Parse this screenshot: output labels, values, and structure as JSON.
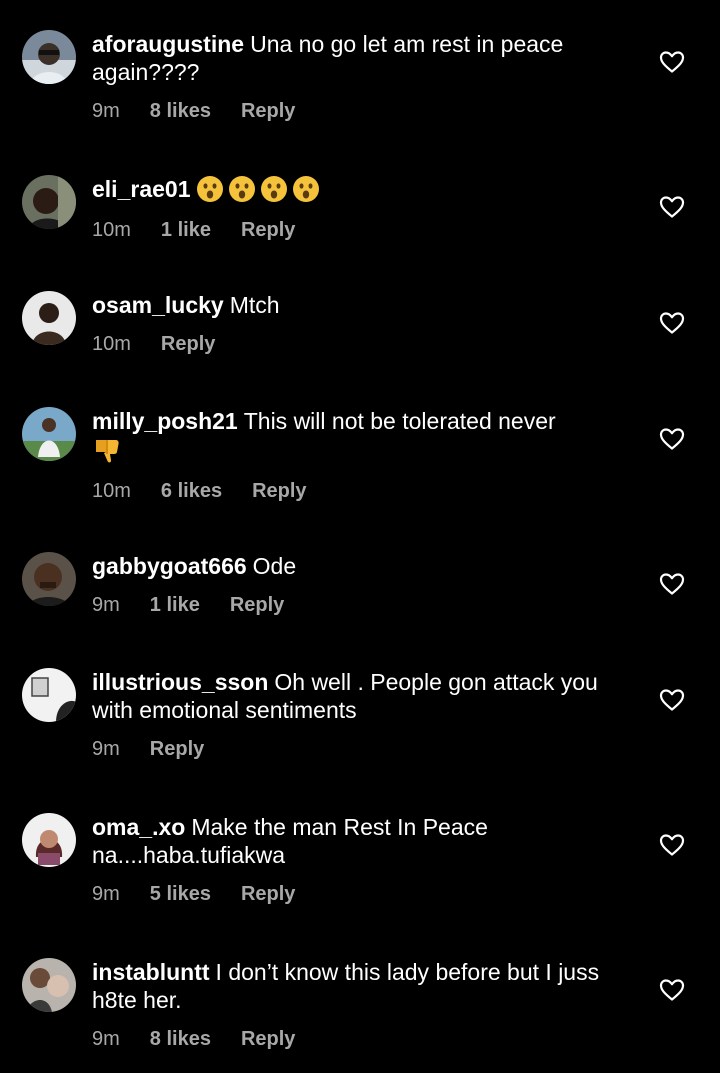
{
  "colors": {
    "background": "#000000",
    "text": "#ffffff",
    "meta": "#a8a8a8"
  },
  "comments": [
    {
      "username": "aforaugustine",
      "text": "Una no go let am rest in peace again????",
      "time": "9m",
      "likes": "8 likes",
      "reply": "Reply",
      "avatar": "profile-photo"
    },
    {
      "username": "eli_rae01",
      "text": "",
      "emojis": [
        "astonished-face",
        "astonished-face",
        "astonished-face",
        "astonished-face"
      ],
      "time": "10m",
      "likes": "1 like",
      "reply": "Reply",
      "avatar": "profile-photo"
    },
    {
      "username": "osam_lucky",
      "text": "Mtch",
      "time": "10m",
      "likes": "",
      "reply": "Reply",
      "avatar": "profile-photo"
    },
    {
      "username": "milly_posh21",
      "text": "This will not be tolerated never",
      "emojis": [
        "thumbs-down"
      ],
      "time": "10m",
      "likes": "6 likes",
      "reply": "Reply",
      "avatar": "profile-photo"
    },
    {
      "username": "gabbygoat666",
      "text": "Ode",
      "time": "9m",
      "likes": "1 like",
      "reply": "Reply",
      "avatar": "profile-photo"
    },
    {
      "username": "illustrious_sson",
      "text": "Oh well . People gon attack you with emotional sentiments",
      "time": "9m",
      "likes": "",
      "reply": "Reply",
      "avatar": "profile-photo"
    },
    {
      "username": "oma_.xo",
      "text": "Make the man Rest In Peace na....haba.tufiakwa",
      "time": "9m",
      "likes": "5 likes",
      "reply": "Reply",
      "avatar": "profile-photo"
    },
    {
      "username": "instabluntt",
      "text": "I don’t know this lady before but I juss h8te her.",
      "time": "9m",
      "likes": "8 likes",
      "reply": "Reply",
      "avatar": "profile-photo"
    }
  ]
}
